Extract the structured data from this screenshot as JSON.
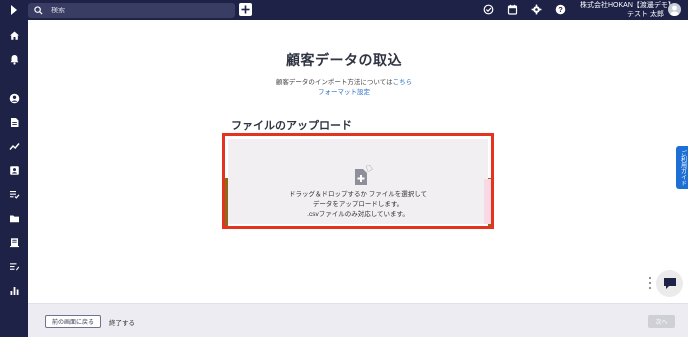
{
  "header": {
    "search_placeholder": "検索",
    "company": "株式会社HOKAN【渡邊デモ】",
    "user": "テスト 太郎"
  },
  "sidebar": {
    "items": [
      "home-icon",
      "bell-icon",
      "person-icon",
      "document-icon",
      "chart-line-icon",
      "contact-card-icon",
      "list-check-icon",
      "folder-icon",
      "building-icon",
      "list-edit-icon",
      "bar-chart-icon"
    ]
  },
  "main": {
    "title": "顧客データの取込",
    "info_prefix": "顧客データのインポート方法については",
    "info_link": "こちら",
    "format_link": "フォーマット設定",
    "section_title": "ファイルのアップロード",
    "drop_text_line1": "ドラッグ＆ドロップするか ファイルを選択して",
    "drop_text_line2": "データをアップロードします。",
    "drop_text_line3": ".csvファイルのみ対応しています。"
  },
  "guide_tab": "ご利用ガイド",
  "footer": {
    "back_label": "前の画面に戻る",
    "end_label": "終了する",
    "next_label": "次へ"
  }
}
